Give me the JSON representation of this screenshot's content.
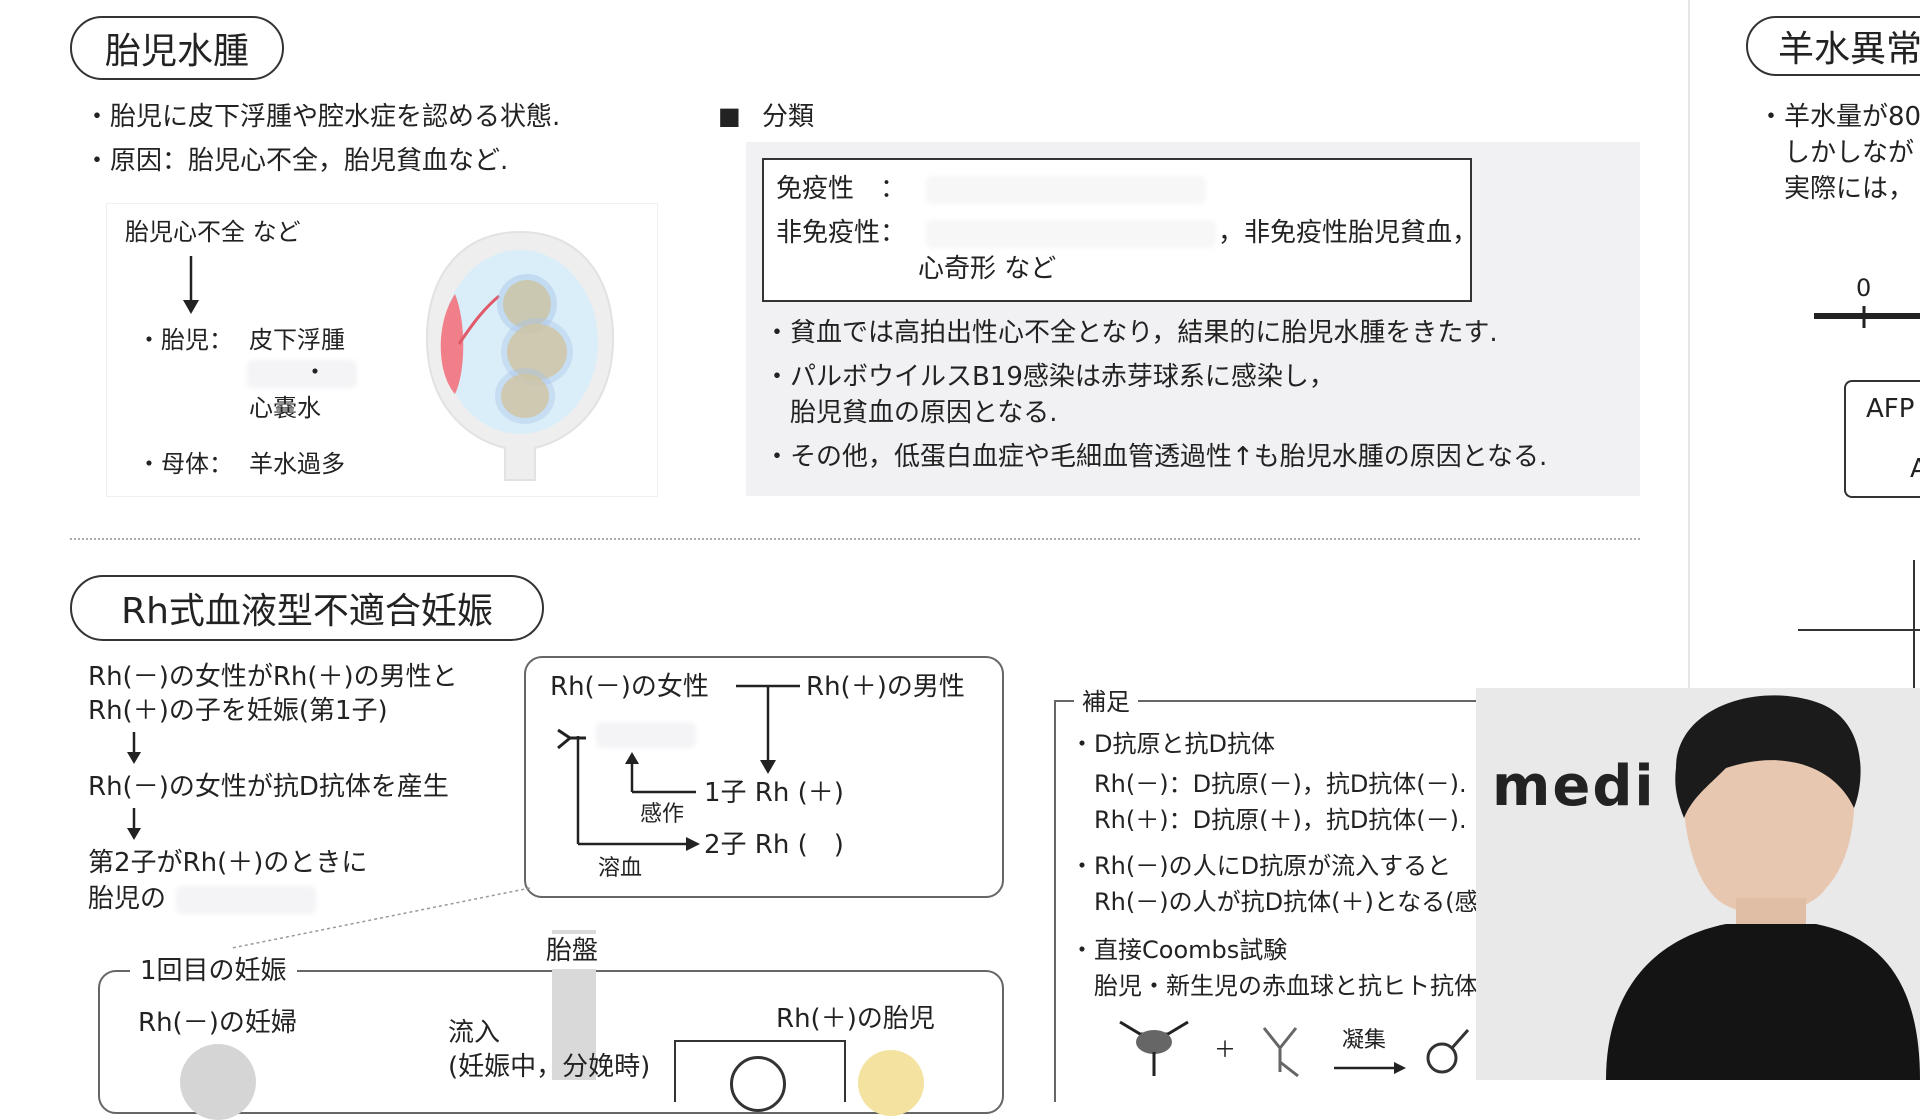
{
  "hydrops": {
    "title": "胎児水腫",
    "bullets": [
      "・胎児に皮下浮腫や腔水症を認める状態.",
      "・原因：胎児心不全，胎児貧血など."
    ],
    "diagram": {
      "cause": "胎児心不全 など",
      "fetus_label": "・胎児：",
      "fetus_item1": "皮下浮腫",
      "fetus_dot": "・",
      "fetus_item2": "心嚢水",
      "mother_label": "・母体：",
      "mother_item": "羊水過多"
    },
    "classification": {
      "marker": "■",
      "heading": "分類",
      "immune_label": "免疫性　：",
      "nonimmune_label": "非免疫性：",
      "nonimmune_suffix": "，非免疫性胎児貧血，",
      "nonimmune_line2": "心奇形 など",
      "notes": [
        "・貧血では高拍出性心不全となり，結果的に胎児水腫をきたす.",
        "・パルボウイルスB19感染は赤芽球系に感染し，",
        "　胎児貧血の原因となる.",
        "・その他，低蛋白血症や毛細血管透過性↑も胎児水腫の原因となる."
      ]
    }
  },
  "amniotic": {
    "title": "羊水異常",
    "lines": [
      "・羊水量が80",
      "　しかしなが",
      "　実際には，"
    ],
    "axis_zero": "0",
    "box_line1": "AFP",
    "box_line2": "A"
  },
  "rh": {
    "title": "Rh式血液型不適合妊娠",
    "flow": [
      "Rh(－)の女性がRh(＋)の男性と",
      "Rh(＋)の子を妊娠(第1子)",
      "Rh(－)の女性が抗D抗体を産生",
      "第2子がRh(＋)のときに",
      "胎児の"
    ],
    "family": {
      "mother": "Rh(－)の女性",
      "father": "Rh(＋)の男性",
      "child1": "1子 Rh (＋)",
      "child2": "2子 Rh (　)",
      "sensitize": "感作",
      "hemolysis": "溶血"
    },
    "first_pregnancy": {
      "heading": "1回目の妊娠",
      "placenta": "胎盤",
      "pregnant": "Rh(－)の妊婦",
      "inflow1": "流入",
      "inflow2": "(妊娠中，分娩時)",
      "fetus": "Rh(＋)の胎児"
    },
    "supplement": {
      "heading": "補足",
      "items": [
        "・D抗原と抗D抗体",
        "　Rh(－)：D抗原(－)，抗D抗体(－).",
        "　Rh(＋)：D抗原(＋)，抗D抗体(－).",
        "・Rh(－)の人にD抗原が流入すると",
        "　Rh(－)の人が抗D抗体(＋)となる(感",
        "・直接Coombs試験",
        "　胎児・新生児の赤血球と抗ヒト抗体"
      ],
      "agglutination": "凝集",
      "plus": "＋"
    }
  },
  "webcam": {
    "logo": "medi"
  },
  "colors": {
    "line": "#333333",
    "panel": "#f1f1f3",
    "accent_red": "#f07f8a",
    "fetus_blue": "#a9c4e8"
  }
}
